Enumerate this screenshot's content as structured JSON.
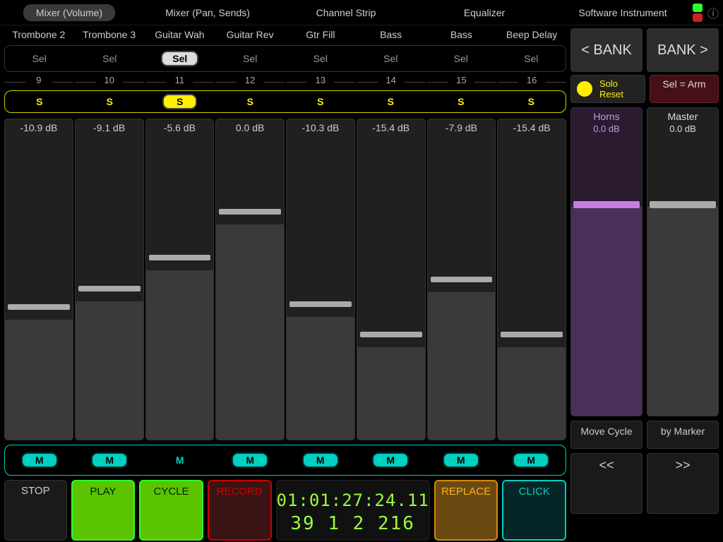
{
  "tabs": [
    "Mixer (Volume)",
    "Mixer (Pan, Sends)",
    "Channel Strip",
    "Equalizer",
    "Software Instrument"
  ],
  "active_tab": 0,
  "leds": {
    "top": "#2dff2d",
    "bottom": "#d02020"
  },
  "channels": [
    {
      "name": "Trombone 2",
      "num": "9",
      "sel": false,
      "db": "-10.9 dB",
      "mute": true,
      "fill": 0.39,
      "solo": false
    },
    {
      "name": "Trombone 3",
      "num": "10",
      "sel": false,
      "db": "-9.1 dB",
      "mute": true,
      "fill": 0.45,
      "solo": false
    },
    {
      "name": "Guitar Wah",
      "num": "11",
      "sel": true,
      "db": "-5.6 dB",
      "mute": false,
      "fill": 0.55,
      "solo": true
    },
    {
      "name": "Guitar Rev",
      "num": "12",
      "sel": false,
      "db": "0.0 dB",
      "mute": true,
      "fill": 0.7,
      "solo": false
    },
    {
      "name": "Gtr Fill",
      "num": "13",
      "sel": false,
      "db": "-10.3 dB",
      "mute": true,
      "fill": 0.4,
      "solo": false
    },
    {
      "name": "Bass",
      "num": "14",
      "sel": false,
      "db": "-15.4 dB",
      "mute": true,
      "fill": 0.3,
      "solo": false
    },
    {
      "name": "Bass",
      "num": "15",
      "sel": false,
      "db": "-7.9 dB",
      "mute": true,
      "fill": 0.48,
      "solo": false
    },
    {
      "name": "Beep Delay",
      "num": "16",
      "sel": false,
      "db": "-15.4 dB",
      "mute": true,
      "fill": 0.3,
      "solo": false
    }
  ],
  "sel_label": "Sel",
  "solo_label": "S",
  "mute_label": "M",
  "bank_prev": "< BANK",
  "bank_next": "BANK >",
  "solo_reset": "Solo\nReset",
  "sel_arm": "Sel = Arm",
  "horns": {
    "title": "Horns",
    "db": "0.0 dB"
  },
  "master": {
    "title": "Master",
    "db": "0.0 dB"
  },
  "move_cycle": "Move Cycle",
  "by_marker": "by Marker",
  "seek_back": "<<",
  "seek_fwd": ">>",
  "transport": {
    "stop": "STOP",
    "play": "PLAY",
    "cycle": "CYCLE",
    "record": "RECORD",
    "replace": "REPLACE",
    "click": "CLICK"
  },
  "timecode1": "01:01:27:24.11",
  "timecode2": "39  1  2 216"
}
